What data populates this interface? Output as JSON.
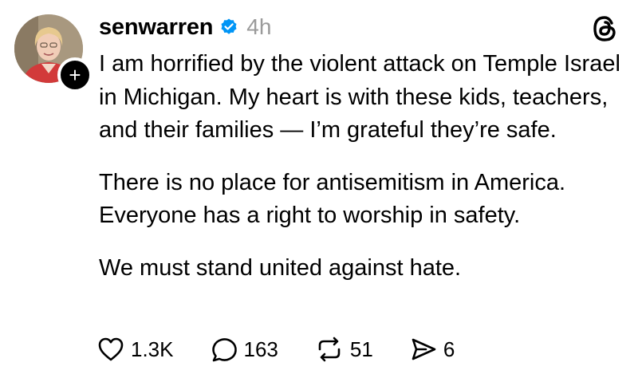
{
  "post": {
    "username": "senwarren",
    "time": "4h",
    "paragraphs": [
      "I am horrified by the violent attack on Temple Israel in Michigan. My heart is with these kids, teachers, and their families — I’m grateful they’re safe.",
      "There is no place for antisemitism in America. Everyone has a right to worship in safety.",
      "We must stand united against hate."
    ],
    "follow_badge": "+",
    "actions": {
      "likes": "1.3K",
      "replies": "163",
      "reposts": "51",
      "shares": "6"
    }
  },
  "icons": {
    "verified": "verified-badge-icon",
    "threads": "threads-logo-icon",
    "like": "heart-icon",
    "reply": "speech-bubble-icon",
    "repost": "repost-icon",
    "share": "send-icon"
  },
  "colors": {
    "verified": "#0095f6",
    "timestamp": "#9a9a9a",
    "text": "#000000",
    "background": "#ffffff"
  }
}
